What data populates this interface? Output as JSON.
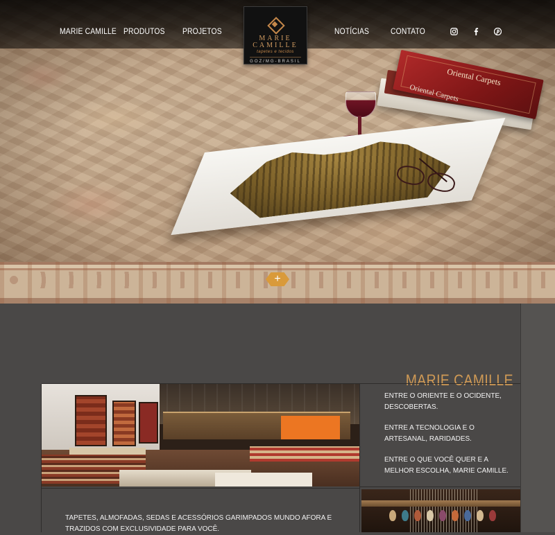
{
  "nav": {
    "left": [
      "MARIE CAMILLE",
      "PRODUTOS",
      "PROJETOS"
    ],
    "right": [
      "NOTÍCIAS",
      "CONTATO"
    ]
  },
  "logo": {
    "line1": "MARIE",
    "line2": "CAMILLE",
    "tagline": "tapetes e tecidos",
    "origin": "GOZ/MG-BRASIL"
  },
  "social": [
    "instagram-icon",
    "facebook-icon",
    "pinterest-icon"
  ],
  "hero": {
    "book_title_1": "Oriental Carpets",
    "book_title_2": "Oriental Carpets",
    "more_button": "+"
  },
  "section": {
    "title": "MARIE CAMILLE",
    "intro": [
      "ENTRE O ORIENTE E O OCIDENTE, DESCOBERTAS.",
      "ENTRE A TECNOLOGIA E O ARTESANAL, RARIDADES.",
      "ENTRE O QUE VOCÊ QUER E A MELHOR ESCOLHA, MARIE CAMILLE."
    ],
    "description": "TAPETES, ALMOFADAS, SEDAS E ACESSÓRIOS GARIMPADOS MUNDO AFORA E TRAZIDOS COM EXCLUSIVIDADE PARA VOCÊ."
  },
  "colors": {
    "accent": "#d09a55",
    "background": "#4a4847",
    "plus_button": "#d99a3a"
  }
}
